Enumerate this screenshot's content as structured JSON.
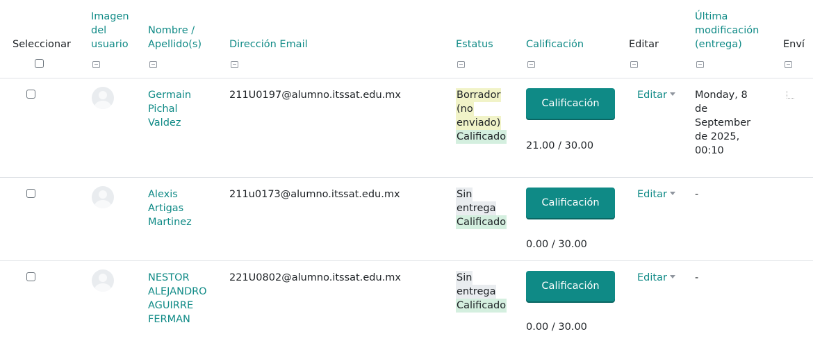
{
  "columns": {
    "select": "Seleccionar",
    "image": "Imagen del usuario",
    "name": "Nombre / Apellido(s)",
    "email": "Dirección Email",
    "status": "Estatus",
    "grade": "Calificación",
    "edit": "Editar",
    "modified": "Última modificación (entrega)",
    "submission": "Enví"
  },
  "rows": [
    {
      "name": "Germain Pichal Valdez",
      "email": "211U0197@alumno.itssat.edu.mx",
      "status_primary": [
        "Borrador",
        "(no",
        "enviado)"
      ],
      "status_primary_kind": "draft",
      "status_secondary": "Calificado",
      "grade_button": "Calificación",
      "grade_value": "21.00 / 30.00",
      "edit_label": "Editar",
      "modified": [
        "Monday, 8",
        "de",
        "September",
        "de 2025,",
        "00:10"
      ]
    },
    {
      "name": "Alexis Artigas Martinez",
      "email": "211u0173@alumno.itssat.edu.mx",
      "status_primary": [
        "Sin",
        "entrega"
      ],
      "status_primary_kind": "none",
      "status_secondary": "Calificado",
      "grade_button": "Calificación",
      "grade_value": "0.00 / 30.00",
      "edit_label": "Editar",
      "modified": [
        "-"
      ]
    },
    {
      "name": "NESTOR ALEJANDRO AGUIRRE FERMAN",
      "email": "221U0802@alumno.itssat.edu.mx",
      "status_primary": [
        "Sin",
        "entrega"
      ],
      "status_primary_kind": "none",
      "status_secondary": "Calificado",
      "grade_button": "Calificación",
      "grade_value": "0.00 / 30.00",
      "edit_label": "Editar",
      "modified": [
        "-"
      ]
    }
  ],
  "colors": {
    "link": "#0f8a86",
    "draft_bg": "#f1f3c8",
    "none_bg": "#e9ecef",
    "graded_bg": "#d4efdf"
  }
}
